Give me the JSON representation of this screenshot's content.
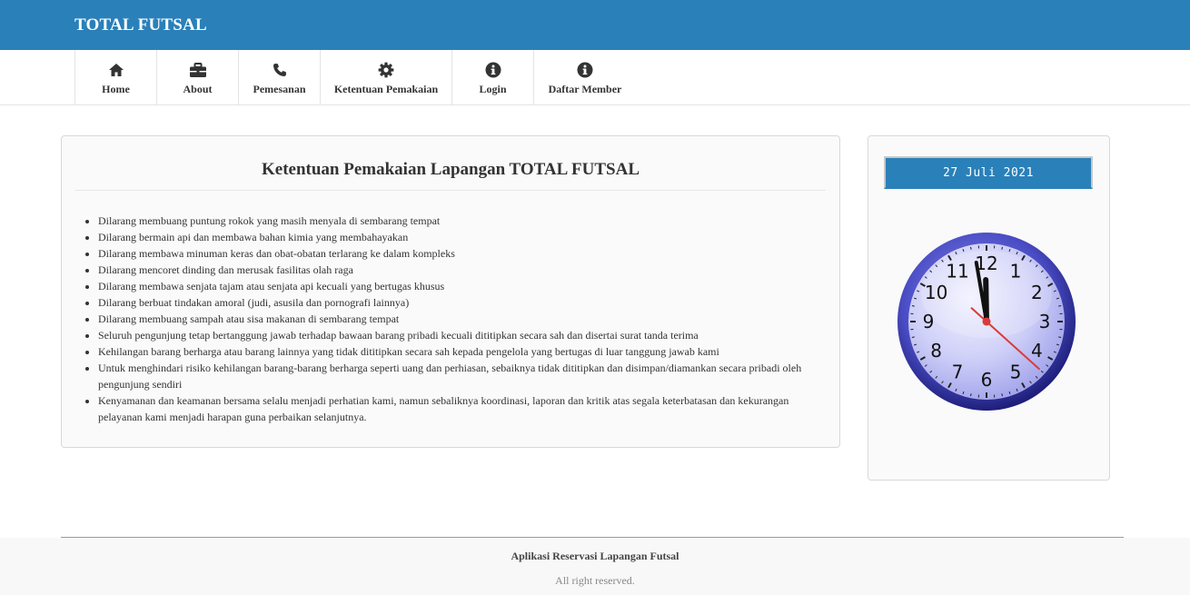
{
  "brand": {
    "title": "TOTAL FUTSAL"
  },
  "nav": {
    "items": [
      {
        "label": "Home",
        "icon": "home-icon"
      },
      {
        "label": "About",
        "icon": "briefcase-icon"
      },
      {
        "label": "Pemesanan",
        "icon": "phone-icon"
      },
      {
        "label": "Ketentuan Pemakaian",
        "icon": "gear-icon"
      },
      {
        "label": "Login",
        "icon": "info-icon"
      },
      {
        "label": "Daftar Member",
        "icon": "info-icon"
      }
    ]
  },
  "main": {
    "title": "Ketentuan Pemakaian Lapangan TOTAL FUTSAL",
    "rules": [
      "Dilarang membuang puntung rokok yang masih menyala di sembarang tempat",
      "Dilarang bermain api dan membawa bahan kimia yang membahayakan",
      "Dilarang membawa minuman keras dan obat-obatan terlarang ke dalam kompleks",
      "Dilarang mencoret dinding dan merusak fasilitas olah raga",
      "Dilarang membawa senjata tajam atau senjata api kecuali yang bertugas khusus",
      "Dilarang berbuat tindakan amoral (judi, asusila dan pornografi lainnya)",
      "Dilarang membuang sampah atau sisa makanan di sembarang tempat",
      "Seluruh pengunjung tetap bertanggung jawab terhadap bawaan barang pribadi kecuali dititipkan secara sah dan disertai surat tanda terima",
      "Kehilangan barang berharga atau barang lainnya yang tidak dititipkan secara sah kepada pengelola yang bertugas di luar tanggung jawab kami",
      "Untuk menghindari risiko kehilangan barang-barang berharga seperti uang dan perhiasan, sebaiknya tidak dititipkan dan disimpan/diamankan secara pribadi oleh pengunjung sendiri",
      "Kenyamanan dan keamanan bersama selalu menjadi perhatian kami, namun sebaliknya koordinasi, laporan dan kritik atas segala keterbatasan dan kekurangan pelayanan kami menjadi harapan guna perbaikan selanjutnya."
    ]
  },
  "sidebar": {
    "date": "27 Juli 2021",
    "clock": {
      "numerals": [
        "12",
        "1",
        "2",
        "3",
        "4",
        "5",
        "6",
        "7",
        "8",
        "9",
        "10",
        "11"
      ],
      "hour": 11,
      "minute": 58,
      "second": 22
    }
  },
  "footer": {
    "title": "Aplikasi Reservasi Lapangan Futsal",
    "subtitle": "All right reserved."
  },
  "colors": {
    "primary": "#2a80b9",
    "clock_face": "#c7c9f5",
    "clock_rim": "#3d3fb5",
    "second_hand": "#d93a3a"
  }
}
